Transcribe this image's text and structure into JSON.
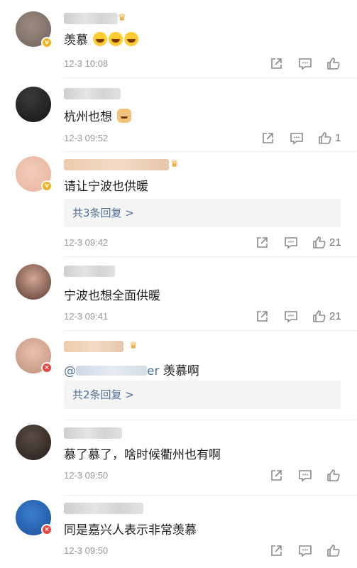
{
  "comments": [
    {
      "text": "羡慕",
      "time": "12-3 10:08",
      "like_count": "",
      "replies": ""
    },
    {
      "text": "杭州也想",
      "time": "12-3 09:52",
      "like_count": "1",
      "replies": ""
    },
    {
      "text": "请让宁波也供暖",
      "time": "12-3 09:42",
      "like_count": "21",
      "replies": "共3条回复 >"
    },
    {
      "text": "宁波也想全面供暖",
      "time": "12-3 09:41",
      "like_count": "21",
      "replies": ""
    },
    {
      "mention_suffix": "er",
      "mention_prefix": "@",
      "text": "羡慕啊",
      "time": "",
      "like_count": "",
      "replies": "共2条回复 >"
    },
    {
      "text": "慕了慕了，啥时候衢州也有啊",
      "time": "12-3 09:50",
      "like_count": "",
      "replies": ""
    },
    {
      "text": "同是嘉兴人表示非常羡慕",
      "time": "12-3 09:50",
      "like_count": "",
      "replies": ""
    }
  ],
  "icons": {
    "repost": "share-icon",
    "comment": "comment-icon",
    "like": "thumb-up-icon"
  },
  "colors": {
    "link": "#4e6e96",
    "meta": "#999999",
    "badge_gold": "#f3b223",
    "badge_red": "#e8463f"
  }
}
